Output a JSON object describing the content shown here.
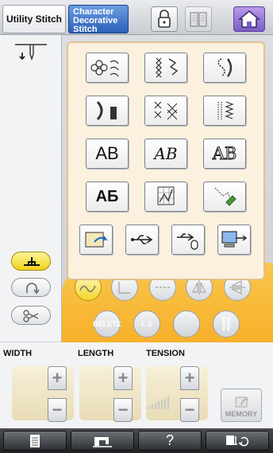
{
  "tabs": {
    "utility": "Utility Stitch",
    "character": [
      "Character",
      "Decorative",
      "Stitch"
    ]
  },
  "categories": {
    "text_script": "AB",
    "text_gothic": "AB",
    "text_outline": "AB",
    "text_cyrillic": "АБ"
  },
  "round_buttons": {
    "delete": "DELETE",
    "ls": "L S"
  },
  "controls": {
    "width_label": "WIDTH",
    "length_label": "LENGTH",
    "tension_label": "TENSION",
    "plus": "+",
    "minus": "−",
    "memory_label": "MEMORY"
  },
  "nav": {
    "help": "?"
  },
  "colors": {
    "accent_orange": "#f7b02a",
    "tab_blue": "#2a5fb8",
    "home_purple": "#7b5cc4",
    "selected_yellow": "#f3d52b"
  }
}
